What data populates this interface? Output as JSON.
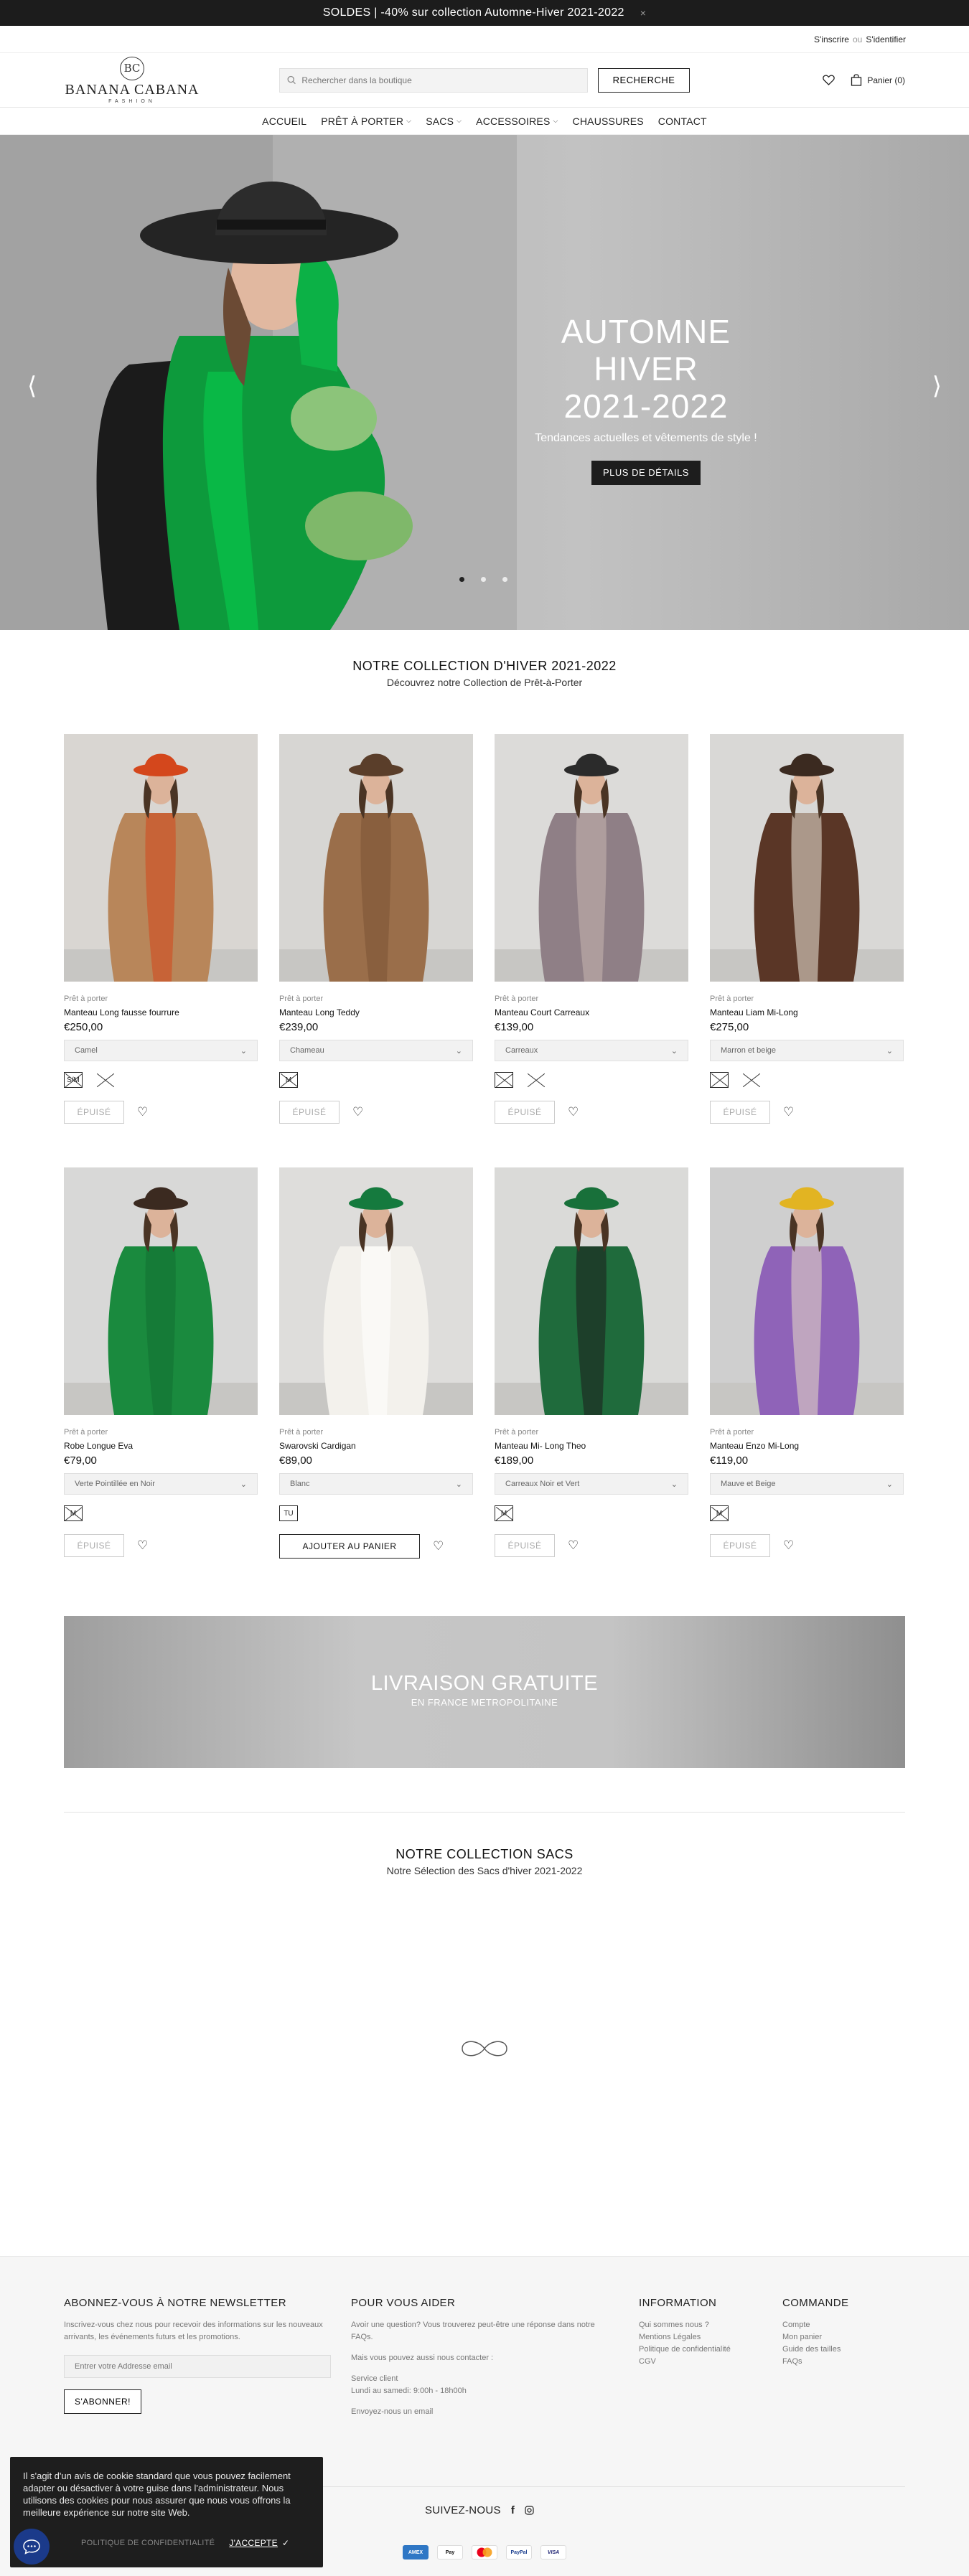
{
  "promo": {
    "text": "SOLDES | -40% sur collection Automne-Hiver 2021-2022",
    "close": "×"
  },
  "account": {
    "signup": "S'inscrire",
    "or": "ou",
    "login": "S'identifier"
  },
  "logo": {
    "monogram": "BC",
    "name": "BANANA CABANA",
    "sub": "FASHION"
  },
  "search": {
    "placeholder": "Rechercher dans la boutique",
    "button": "RECHERCHE"
  },
  "cart": {
    "label": "Panier (0)"
  },
  "nav": [
    {
      "label": "ACCUEIL",
      "dropdown": false
    },
    {
      "label": "PRÊT À PORTER",
      "dropdown": true
    },
    {
      "label": "SACS",
      "dropdown": true
    },
    {
      "label": "ACCESSOIRES",
      "dropdown": true
    },
    {
      "label": "CHAUSSURES",
      "dropdown": false
    },
    {
      "label": "CONTACT",
      "dropdown": false
    }
  ],
  "hero": {
    "title_line1": "AUTOMNE HIVER",
    "title_line2": "2021-2022",
    "subtitle": "Tendances actuelles et vêtements de style !",
    "cta": "PLUS DE DÉTAILS",
    "slides": 3,
    "active_slide": 1
  },
  "collection": {
    "title": "NOTRE COLLECTION D'HIVER 2021-2022",
    "subtitle": "Découvrez notre Collection de Prêt-à-Porter"
  },
  "products": [
    {
      "category": "Prêt à porter",
      "title": "Manteau Long fausse fourrure",
      "price": "€250,00",
      "option": "Camel",
      "sizes": [
        {
          "label": "S/M",
          "out": true,
          "boxed": true
        },
        {
          "label": "",
          "out": true,
          "boxed": false
        }
      ],
      "action": "ÉPUISÉ",
      "available": false,
      "colors": {
        "bg": "#d9d6d2",
        "coat": "#b8865a",
        "accent": "#d4471c",
        "hat": "#d4471c"
      }
    },
    {
      "category": "Prêt à porter",
      "title": "Manteau Long Teddy",
      "price": "€239,00",
      "option": "Chameau",
      "sizes": [
        {
          "label": "M",
          "out": true,
          "boxed": true
        }
      ],
      "action": "ÉPUISÉ",
      "available": false,
      "colors": {
        "bg": "#d7d6d3",
        "coat": "#9a6e4a",
        "accent": "#7b5335",
        "hat": "#5a3e2a"
      }
    },
    {
      "category": "Prêt à porter",
      "title": "Manteau Court Carreaux",
      "price": "€139,00",
      "option": "Carreaux",
      "sizes": [
        {
          "label": "",
          "out": true,
          "boxed": true
        },
        {
          "label": "",
          "out": true,
          "boxed": false
        }
      ],
      "action": "ÉPUISÉ",
      "available": false,
      "colors": {
        "bg": "#dcdbd9",
        "coat": "#8f7f86",
        "accent": "#c9b7b0",
        "hat": "#2b2b2b"
      }
    },
    {
      "category": "Prêt à porter",
      "title": "Manteau Liam Mi-Long",
      "price": "€275,00",
      "option": "Marron et beige",
      "sizes": [
        {
          "label": "",
          "out": true,
          "boxed": true
        },
        {
          "label": "",
          "out": true,
          "boxed": false
        }
      ],
      "action": "ÉPUISÉ",
      "available": false,
      "colors": {
        "bg": "#d9d8d6",
        "coat": "#5a3626",
        "accent": "#efe9dc",
        "hat": "#3b2a20"
      }
    },
    {
      "category": "Prêt à porter",
      "title": "Robe Longue Eva",
      "price": "€79,00",
      "option": "Verte Pointillée en Noir",
      "sizes": [
        {
          "label": "M",
          "out": true,
          "boxed": true
        }
      ],
      "action": "ÉPUISÉ",
      "available": false,
      "colors": {
        "bg": "#d8d8d7",
        "coat": "#1a8a3e",
        "accent": "#137032",
        "hat": "#3b2a20"
      }
    },
    {
      "category": "Prêt à porter",
      "title": "Swarovski Cardigan",
      "price": "€89,00",
      "option": "Blanc",
      "sizes": [
        {
          "label": "TU",
          "out": false,
          "boxed": true
        }
      ],
      "action": "AJOUTER AU PANIER",
      "available": true,
      "colors": {
        "bg": "#dedddb",
        "coat": "#f3f1ec",
        "accent": "#ffffff",
        "hat": "#157a3e"
      }
    },
    {
      "category": "Prêt à porter",
      "title": "Manteau Mi- Long Theo",
      "price": "€189,00",
      "option": "Carreaux Noir et Vert",
      "sizes": [
        {
          "label": "M",
          "out": true,
          "boxed": true
        }
      ],
      "action": "ÉPUISÉ",
      "available": false,
      "colors": {
        "bg": "#dadad8",
        "coat": "#1f6b3c",
        "accent": "#1c1c1c",
        "hat": "#18703a"
      }
    },
    {
      "category": "Prêt à porter",
      "title": "Manteau Enzo Mi-Long",
      "price": "€119,00",
      "option": "Mauve et Beige",
      "sizes": [
        {
          "label": "M",
          "out": true,
          "boxed": true
        }
      ],
      "action": "ÉPUISÉ",
      "available": false,
      "colors": {
        "bg": "#cfcfcf",
        "coat": "#8f63b8",
        "accent": "#e8dcc4",
        "hat": "#e2b422"
      }
    }
  ],
  "banner": {
    "title": "LIVRAISON GRATUITE",
    "subtitle": "EN FRANCE METROPOLITAINE"
  },
  "bags": {
    "title": "NOTRE COLLECTION SACS",
    "subtitle": "Notre Sélection des Sacs d'hiver 2021-2022"
  },
  "footer": {
    "newsletter": {
      "title": "ABONNEZ-VOUS À NOTRE NEWSLETTER",
      "text": "Inscrivez-vous chez nous pour recevoir des informations sur les nouveaux arrivants, les événements futurs et les promotions.",
      "placeholder": "Entrer votre Addresse email",
      "button": "S'ABONNER!"
    },
    "help": {
      "title": "POUR VOUS AIDER",
      "lines": [
        "Avoir une question? Vous trouverez peut-être une réponse dans notre FAQs.",
        "Mais vous pouvez aussi nous contacter :",
        "Service client",
        "Lundi au samedi: 9:00h - 18h00h",
        "Envoyez-nous un email"
      ]
    },
    "info": {
      "title": "INFORMATION",
      "links": [
        "Qui sommes nous ?",
        "Mentions Légales",
        "Politique de confidentialité",
        "CGV"
      ]
    },
    "order": {
      "title": "COMMANDE",
      "links": [
        "Compte",
        "Mon panier",
        "Guide des tailles",
        "FAQs"
      ]
    },
    "follow": "SUIVEZ-NOUS",
    "payments": [
      "AMEX",
      "Pay",
      "MC",
      "PayPal",
      "VISA"
    ]
  },
  "cookie": {
    "text": "Il s'agit d'un avis de cookie standard que vous pouvez facilement adapter ou désactiver à votre guise dans l'administrateur. Nous utilisons des cookies pour nous assurer que nous vous offrons la meilleure expérience sur notre site Web.",
    "policy": "POLITIQUE DE CONFIDENTIALITÉ",
    "accept": "J'ACCEPTE"
  }
}
